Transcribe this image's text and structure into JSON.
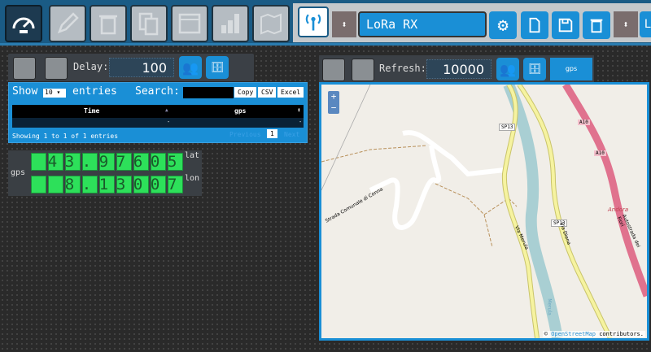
{
  "toolbar": {
    "buttons": [
      "dashboard-icon",
      "pencil-icon",
      "trash-icon",
      "copy-icon",
      "table-icon",
      "bar-chart-icon",
      "map-icon",
      "antenna-icon"
    ],
    "device_name": "LoRa RX",
    "right_buttons": [
      "gear-icon",
      "new-file-icon",
      "save-icon",
      "trash-icon"
    ],
    "truncated_field": "L"
  },
  "left_panel": {
    "delay_label": "Delay:",
    "delay_value": "100"
  },
  "table": {
    "show_label": "Show",
    "entries_label": "entries",
    "page_size": "10",
    "search_label": "Search:",
    "search_value": "",
    "export_buttons": [
      "Copy",
      "CSV",
      "Excel"
    ],
    "columns": [
      "Time",
      "gps"
    ],
    "rows": [
      [
        "-",
        "-"
      ]
    ],
    "info": "Showing 1 to 1 of 1 entries",
    "prev": "Previous",
    "page": "1",
    "next": "Next"
  },
  "gps_widget": {
    "label": "gps",
    "lat_label": "lat",
    "lat_value": "43.97605",
    "lon_label": "lon",
    "lon_value": "8.13007",
    "lat_cells": [
      "",
      "",
      "4",
      "3.",
      "9",
      "7",
      "6",
      "0",
      "5"
    ],
    "lon_cells": [
      "",
      "",
      "",
      "8.",
      "1",
      "3",
      "0",
      "0",
      "7"
    ]
  },
  "right_panel": {
    "refresh_label": "Refresh:",
    "refresh_value": "10000",
    "tag": "gps"
  },
  "map": {
    "zoom_in": "+",
    "zoom_out": "−",
    "labels": {
      "via_merula": "Via Merula",
      "via_diena": "Via Diena",
      "sp13": "SP13",
      "a10": "A10",
      "andora": "Andora",
      "autostrada": "Autostrada dei Fiori",
      "strada": "Strada Comunale di Conna",
      "merula": "Merula"
    },
    "attribution_prefix": "© ",
    "attribution_link": "OpenStreetMap",
    "attribution_suffix": " contributors."
  },
  "colors": {
    "accent": "#1a8fd6",
    "lcd_green": "#2de05a",
    "topbar": "#1a5b85"
  }
}
